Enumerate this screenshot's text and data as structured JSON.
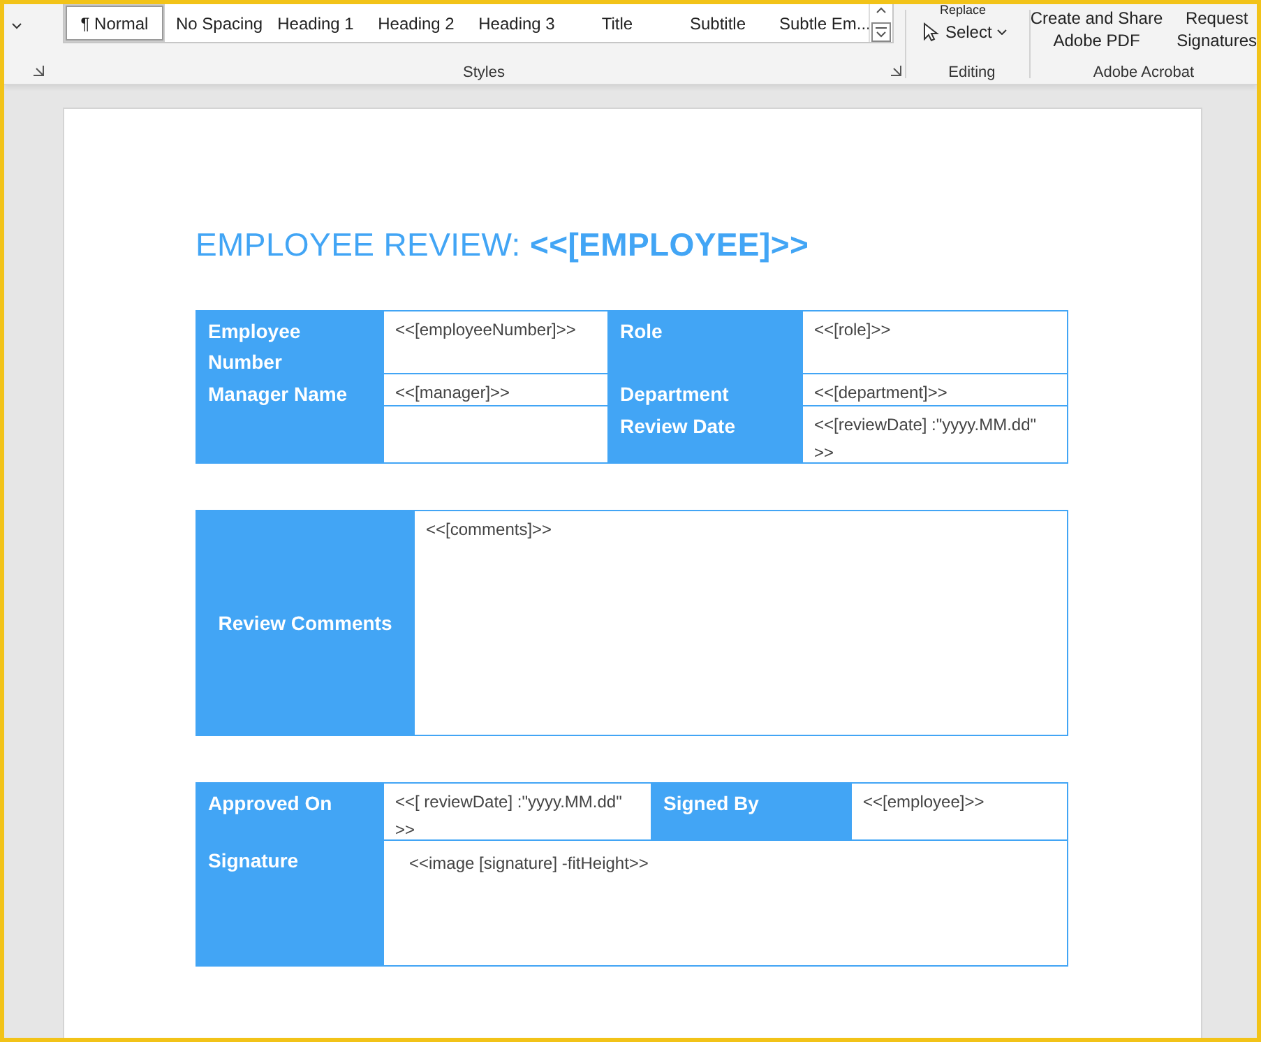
{
  "ribbon": {
    "styles": [
      {
        "label": "¶ Normal",
        "selected": true
      },
      {
        "label": "No Spacing",
        "selected": false
      },
      {
        "label": "Heading 1",
        "selected": false
      },
      {
        "label": "Heading 2",
        "selected": false
      },
      {
        "label": "Heading 3",
        "selected": false
      },
      {
        "label": "Title",
        "selected": false
      },
      {
        "label": "Subtitle",
        "selected": false
      },
      {
        "label": "Subtle Em...",
        "selected": false
      }
    ],
    "styles_group": "Styles",
    "editing": {
      "replace": "Replace",
      "select": "Select",
      "group": "Editing"
    },
    "acrobat": {
      "create": [
        "Create and Share",
        "Adobe PDF"
      ],
      "request": [
        "Request",
        "Signatures"
      ],
      "group": "Adobe Acrobat"
    }
  },
  "document": {
    "title": "EMPLOYEE REVIEW: ",
    "title_field": "<<[EMPLOYEE]>>",
    "info_table": {
      "left": [
        {
          "label": "Employee Number",
          "value": "<<[employeeNumber]>>"
        },
        {
          "label": "Manager Name",
          "value": "<<[manager]>>"
        }
      ],
      "right": [
        {
          "label": "Role",
          "value": "<<[role]>>"
        },
        {
          "label": "Department",
          "value": "<<[department]>>"
        },
        {
          "label": "Review Date",
          "value": "<<[reviewDate] :\"yyyy.MM.dd\" >>"
        }
      ]
    },
    "comments": {
      "label": "Review Comments",
      "value": "<<[comments]>>"
    },
    "approval": {
      "approved_label": "Approved On",
      "approved_value": "<<[ reviewDate] :\"yyyy.MM.dd\" >>",
      "signed_label": "Signed By",
      "signed_value": "<<[employee]>>",
      "signature_label": "Signature",
      "signature_value": "<<image [signature] -fitHeight>>"
    }
  }
}
